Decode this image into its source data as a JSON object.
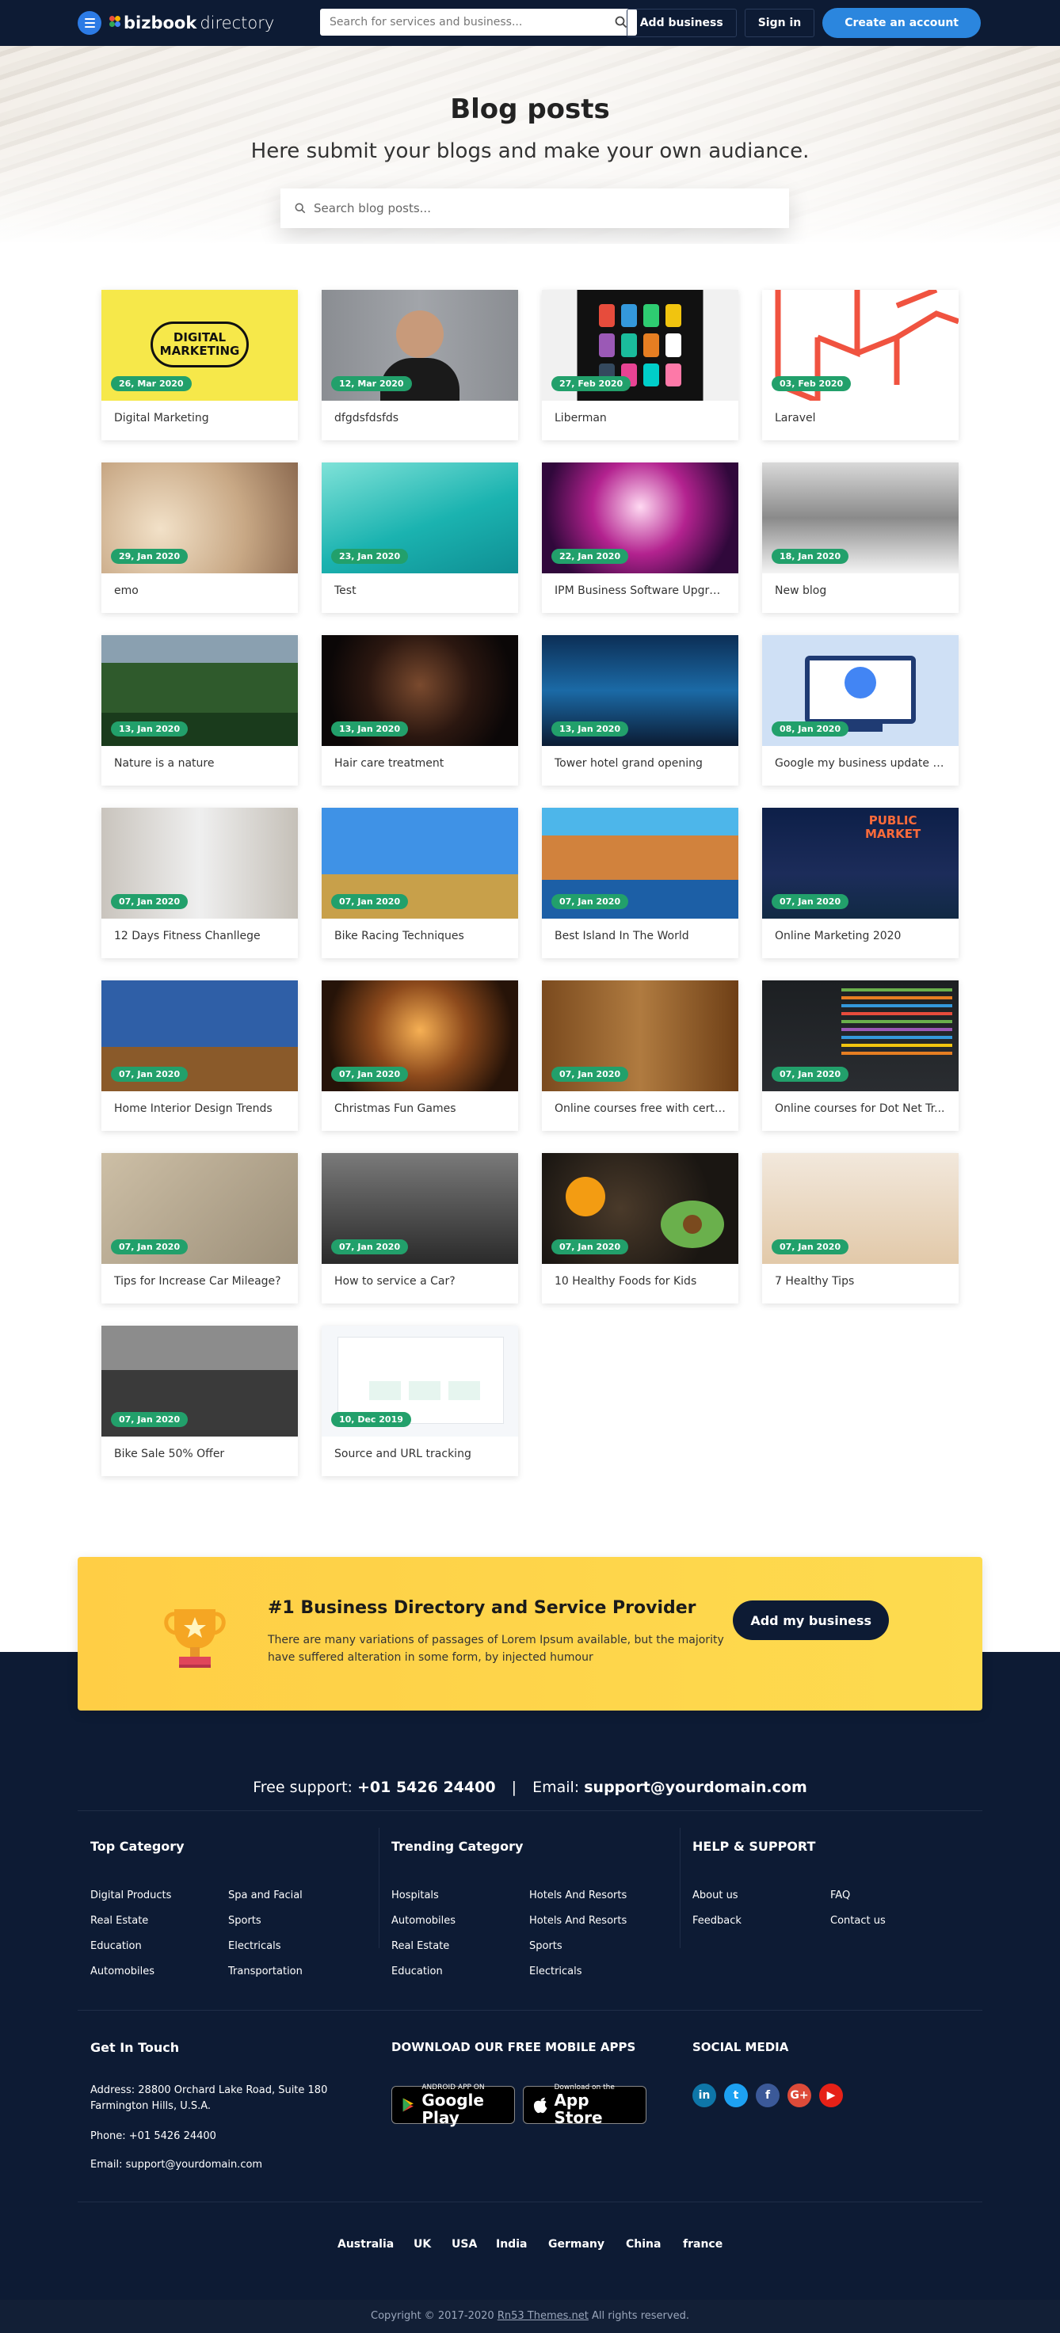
{
  "nav": {
    "logo_bold": "bizbook",
    "logo_light": "directory",
    "search_placeholder": "Search for services and business...",
    "add_business": "Add business",
    "sign_in": "Sign in",
    "create_account": "Create an account"
  },
  "hero": {
    "title": "Blog posts",
    "subtitle": "Here submit your blogs and make your own audiance.",
    "search_placeholder": "Search blog posts..."
  },
  "posts": [
    {
      "date": "26, Mar 2020",
      "title": "Digital Marketing",
      "img": "digital"
    },
    {
      "date": "12, Mar 2020",
      "title": "dfgdsfdsfds",
      "img": "portrait"
    },
    {
      "date": "27, Feb 2020",
      "title": "Liberman",
      "img": "tablet"
    },
    {
      "date": "03, Feb 2020",
      "title": "Laravel",
      "img": "laravel"
    },
    {
      "date": "29, Jan 2020",
      "title": "emo",
      "img": "book"
    },
    {
      "date": "23, Jan 2020",
      "title": "Test",
      "img": "teal"
    },
    {
      "date": "22, Jan 2020",
      "title": "IPM Business Software Upgra...",
      "img": "hall"
    },
    {
      "date": "18, Jan 2020",
      "title": "New blog",
      "img": "snow"
    },
    {
      "date": "13, Jan 2020",
      "title": "Nature is a nature",
      "img": "forest"
    },
    {
      "date": "13, Jan 2020",
      "title": "Hair care treatment",
      "img": "hair"
    },
    {
      "date": "13, Jan 2020",
      "title": "Tower hotel grand opening",
      "img": "hotel"
    },
    {
      "date": "08, Jan 2020",
      "title": "Google my business update f...",
      "img": "google"
    },
    {
      "date": "07, Jan 2020",
      "title": "12 Days Fitness Chanllege",
      "img": "fitness"
    },
    {
      "date": "07, Jan 2020",
      "title": "Bike Racing Techniques",
      "img": "moto"
    },
    {
      "date": "07, Jan 2020",
      "title": "Best Island In The World",
      "img": "island"
    },
    {
      "date": "07, Jan 2020",
      "title": "Online Marketing 2020",
      "img": "market"
    },
    {
      "date": "07, Jan 2020",
      "title": "Home Interior Design Trends",
      "img": "interior"
    },
    {
      "date": "07, Jan 2020",
      "title": "Christmas Fun Games",
      "img": "xmas"
    },
    {
      "date": "07, Jan 2020",
      "title": "Online courses free with certi...",
      "img": "student"
    },
    {
      "date": "07, Jan 2020",
      "title": "Online courses for Dot Net Tr...",
      "img": "code"
    },
    {
      "date": "07, Jan 2020",
      "title": "Tips for Increase Car Mileage?",
      "img": "map"
    },
    {
      "date": "07, Jan 2020",
      "title": "How to service a Car?",
      "img": "car"
    },
    {
      "date": "07, Jan 2020",
      "title": "10 Healthy Foods for Kids",
      "img": "food"
    },
    {
      "date": "07, Jan 2020",
      "title": "7 Healthy Tips",
      "img": "runner"
    },
    {
      "date": "07, Jan 2020",
      "title": "Bike Sale 50% Offer",
      "img": "bikes"
    },
    {
      "date": "10, Dec 2019",
      "title": "Source and URL tracking",
      "img": "dashboard"
    }
  ],
  "cta": {
    "title": "#1 Business Directory and Service Provider",
    "text": "There are many variations of passages of Lorem Ipsum available, but the majority have suffered alteration in some form, by injected humour",
    "button": "Add my business"
  },
  "footer": {
    "support_label": "Free support:",
    "support_phone": "+01 5426 24400",
    "email_label": "Email:",
    "support_email": "support@yourdomain.com",
    "top_category": {
      "title": "Top Category",
      "col1": [
        "Digital Products",
        "Real Estate",
        "Education",
        "Automobiles"
      ],
      "col2": [
        "Spa and Facial",
        "Sports",
        "Electricals",
        "Transportation"
      ]
    },
    "trending_category": {
      "title": "Trending Category",
      "col1": [
        "Hospitals",
        "Automobiles",
        "Real Estate",
        "Education"
      ],
      "col2": [
        "Hotels And Resorts",
        "Hotels And Resorts",
        "Sports",
        "Electricals"
      ]
    },
    "help": {
      "title": "HELP & SUPPORT",
      "col1": [
        "About us",
        "Feedback"
      ],
      "col2": [
        "FAQ",
        "Contact us"
      ]
    },
    "get_in_touch": {
      "title": "Get In Touch",
      "address_line1": "Address: 28800 Orchard Lake Road, Suite 180",
      "address_line2": "Farmington Hills, U.S.A.",
      "phone": "Phone: +01 5426 24400",
      "email": "Email: support@yourdomain.com"
    },
    "apps": {
      "title": "DOWNLOAD OUR FREE MOBILE APPS",
      "google_small": "ANDROID APP ON",
      "google_big": "Google Play",
      "apple_small": "Download on the",
      "apple_big": "App Store"
    },
    "social": {
      "title": "SOCIAL MEDIA",
      "icons": [
        {
          "label": "in",
          "color": "#0e76a8",
          "name": "linkedin-icon"
        },
        {
          "label": "t",
          "color": "#1da1f2",
          "name": "twitter-icon"
        },
        {
          "label": "f",
          "color": "#3b5998",
          "name": "facebook-icon"
        },
        {
          "label": "G+",
          "color": "#dd4b39",
          "name": "google-plus-icon"
        },
        {
          "label": "▶",
          "color": "#e62117",
          "name": "youtube-icon"
        }
      ]
    },
    "countries": [
      "Australia",
      "UK",
      "USA",
      "India",
      "Germany",
      "China",
      "france"
    ],
    "copyright_pre": "Copyright © 2017-2020",
    "copyright_link": "Rn53 Themes.net",
    "copyright_post": "All rights reserved."
  },
  "colors": {
    "navy": "#0d1b34",
    "accent_blue": "#2b86de",
    "date_badge": "#22a06b",
    "cta_yellow": "#ffce45"
  }
}
